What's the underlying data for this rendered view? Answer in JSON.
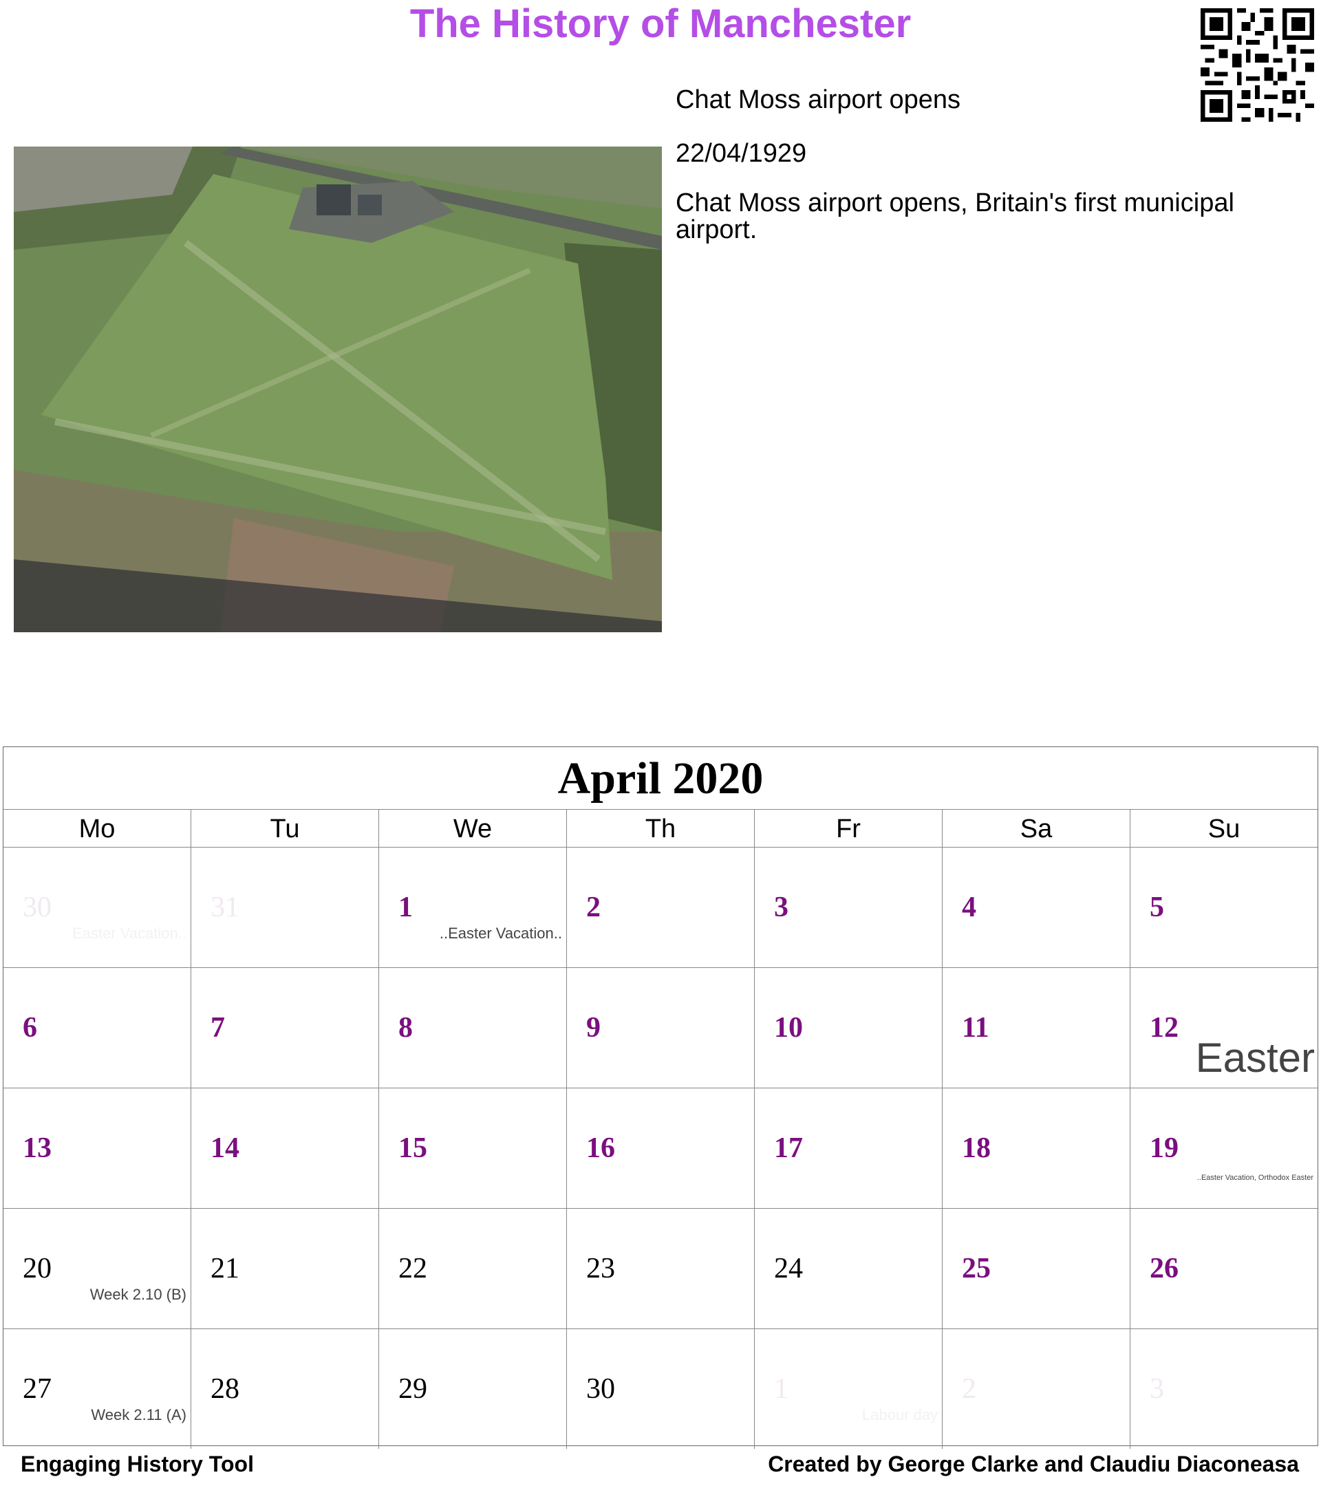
{
  "header": {
    "title": "The History of Manchester"
  },
  "event": {
    "title": "Chat Moss airport opens",
    "date": "22/04/1929",
    "description": "Chat Moss airport opens, Britain's first municipal airport."
  },
  "calendar": {
    "month": "April 2020",
    "days_of_week": [
      "Mo",
      "Tu",
      "We",
      "Th",
      "Fr",
      "Sa",
      "Su"
    ],
    "weeks": [
      [
        {
          "day": "30",
          "style": "faded",
          "note": "Easter Vacation..",
          "note_style": "faded"
        },
        {
          "day": "31",
          "style": "faded",
          "note": ""
        },
        {
          "day": "1",
          "style": "hl",
          "note": "..Easter Vacation..",
          "note_style": "mid"
        },
        {
          "day": "2",
          "style": "hl",
          "note": ""
        },
        {
          "day": "3",
          "style": "hl",
          "note": ""
        },
        {
          "day": "4",
          "style": "hl",
          "note": ""
        },
        {
          "day": "5",
          "style": "hl",
          "note": ""
        }
      ],
      [
        {
          "day": "6",
          "style": "hl",
          "note": ""
        },
        {
          "day": "7",
          "style": "hl",
          "note": ""
        },
        {
          "day": "8",
          "style": "hl",
          "note": ""
        },
        {
          "day": "9",
          "style": "hl",
          "note": ""
        },
        {
          "day": "10",
          "style": "hl",
          "note": ""
        },
        {
          "day": "11",
          "style": "hl",
          "note": ""
        },
        {
          "day": "12",
          "style": "hl",
          "note": "Easter",
          "note_style": "big"
        }
      ],
      [
        {
          "day": "13",
          "style": "hl",
          "note": ""
        },
        {
          "day": "14",
          "style": "hl",
          "note": ""
        },
        {
          "day": "15",
          "style": "hl",
          "note": ""
        },
        {
          "day": "16",
          "style": "hl",
          "note": ""
        },
        {
          "day": "17",
          "style": "hl",
          "note": ""
        },
        {
          "day": "18",
          "style": "hl",
          "note": ""
        },
        {
          "day": "19",
          "style": "hl",
          "note": "..Easter Vacation, Orthodox Easter",
          "note_style": "tiny"
        }
      ],
      [
        {
          "day": "20",
          "style": "plain",
          "note": "Week 2.10 (B)",
          "note_style": "mid"
        },
        {
          "day": "21",
          "style": "plain",
          "note": ""
        },
        {
          "day": "22",
          "style": "plain",
          "note": ""
        },
        {
          "day": "23",
          "style": "plain",
          "note": ""
        },
        {
          "day": "24",
          "style": "plain",
          "note": ""
        },
        {
          "day": "25",
          "style": "hl",
          "note": ""
        },
        {
          "day": "26",
          "style": "hl",
          "note": ""
        }
      ],
      [
        {
          "day": "27",
          "style": "plain",
          "note": "Week 2.11 (A)",
          "note_style": "mid"
        },
        {
          "day": "28",
          "style": "plain",
          "note": ""
        },
        {
          "day": "29",
          "style": "plain",
          "note": ""
        },
        {
          "day": "30",
          "style": "plain",
          "note": ""
        },
        {
          "day": "1",
          "style": "faded",
          "note": "Labour day",
          "note_style": "faded"
        },
        {
          "day": "2",
          "style": "faded",
          "note": ""
        },
        {
          "day": "3",
          "style": "faded",
          "note": ""
        }
      ]
    ]
  },
  "footer": {
    "left": "Engaging History Tool",
    "right": "Created by George Clarke and Claudiu Diaconeasa"
  },
  "colors": {
    "title": "#b44ee6",
    "highlight_day": "#7a0f7f"
  }
}
